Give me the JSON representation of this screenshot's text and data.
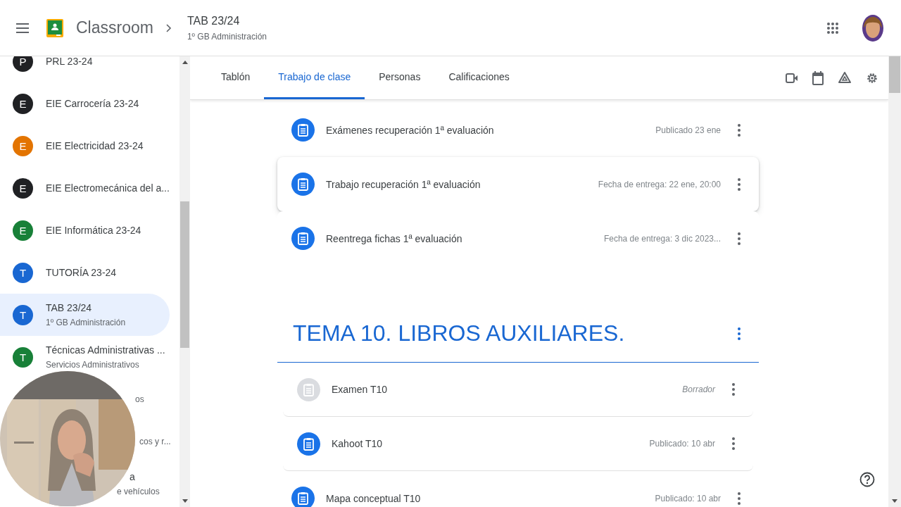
{
  "header": {
    "app_name": "Classroom",
    "class_title": "TAB 23/24",
    "class_subtitle": "1º GB Administración"
  },
  "sidebar": {
    "items": [
      {
        "kind": "class",
        "letter": "P",
        "name": "PRL 23-24",
        "color": "#202124",
        "selected": false
      },
      {
        "kind": "class",
        "letter": "E",
        "name": "EIE Carrocería 23-24",
        "color": "#202124",
        "selected": false
      },
      {
        "kind": "class",
        "letter": "E",
        "name": "EIE Electricidad 23-24",
        "color": "#e37400",
        "selected": false
      },
      {
        "kind": "class",
        "letter": "E",
        "name": "EIE Electromecánica del a...",
        "color": "#202124",
        "selected": false
      },
      {
        "kind": "class",
        "letter": "E",
        "name": "EIE Informática 23-24",
        "color": "#188038",
        "selected": false
      },
      {
        "kind": "class",
        "letter": "T",
        "name": "TUTORÍA 23-24",
        "color": "#1967d2",
        "selected": false
      },
      {
        "kind": "class",
        "letter": "T",
        "name": "TAB 23/24",
        "subtitle": "1º GB Administración",
        "color": "#1967d2",
        "selected": true
      },
      {
        "kind": "class",
        "letter": "T",
        "name": "Técnicas Administrativas ...",
        "subtitle": "Servicios Administrativos",
        "color": "#188038",
        "selected": false
      },
      {
        "kind": "covered",
        "subtitle": "os"
      },
      {
        "kind": "covered",
        "subtitle": "cos y r..."
      },
      {
        "kind": "covered",
        "name": "a",
        "subtitle": "e vehículos"
      }
    ]
  },
  "tabs": [
    {
      "label": "Tablón",
      "selected": false
    },
    {
      "label": "Trabajo de clase",
      "selected": true
    },
    {
      "label": "Personas",
      "selected": false
    },
    {
      "label": "Calificaciones",
      "selected": false
    }
  ],
  "sections": [
    {
      "items": [
        {
          "kind": "assignment",
          "title": "Exámenes recuperación 1ª evaluación",
          "status": "Publicado 23 ene",
          "hovered": false
        },
        {
          "kind": "assignment",
          "title": "Trabajo recuperación 1ª evaluación",
          "status": "Fecha de entrega: 22 ene, 20:00",
          "hovered": true
        },
        {
          "kind": "assignment",
          "title": "Reentrega fichas 1ª evaluación",
          "status": "Fecha de entrega: 3 dic 2023...",
          "hovered": false
        }
      ]
    },
    {
      "topic": "TEMA 10. LIBROS AUXILIARES.",
      "items": [
        {
          "kind": "draft",
          "title": "Examen T10",
          "status": "Borrador",
          "hovered": false
        },
        {
          "kind": "assignment",
          "title": "Kahoot T10",
          "status": "Publicado: 10 abr",
          "hovered": false
        },
        {
          "kind": "assignment",
          "title": "Mapa conceptual T10",
          "status": "Publicado: 10 abr",
          "hovered": false
        }
      ]
    }
  ]
}
